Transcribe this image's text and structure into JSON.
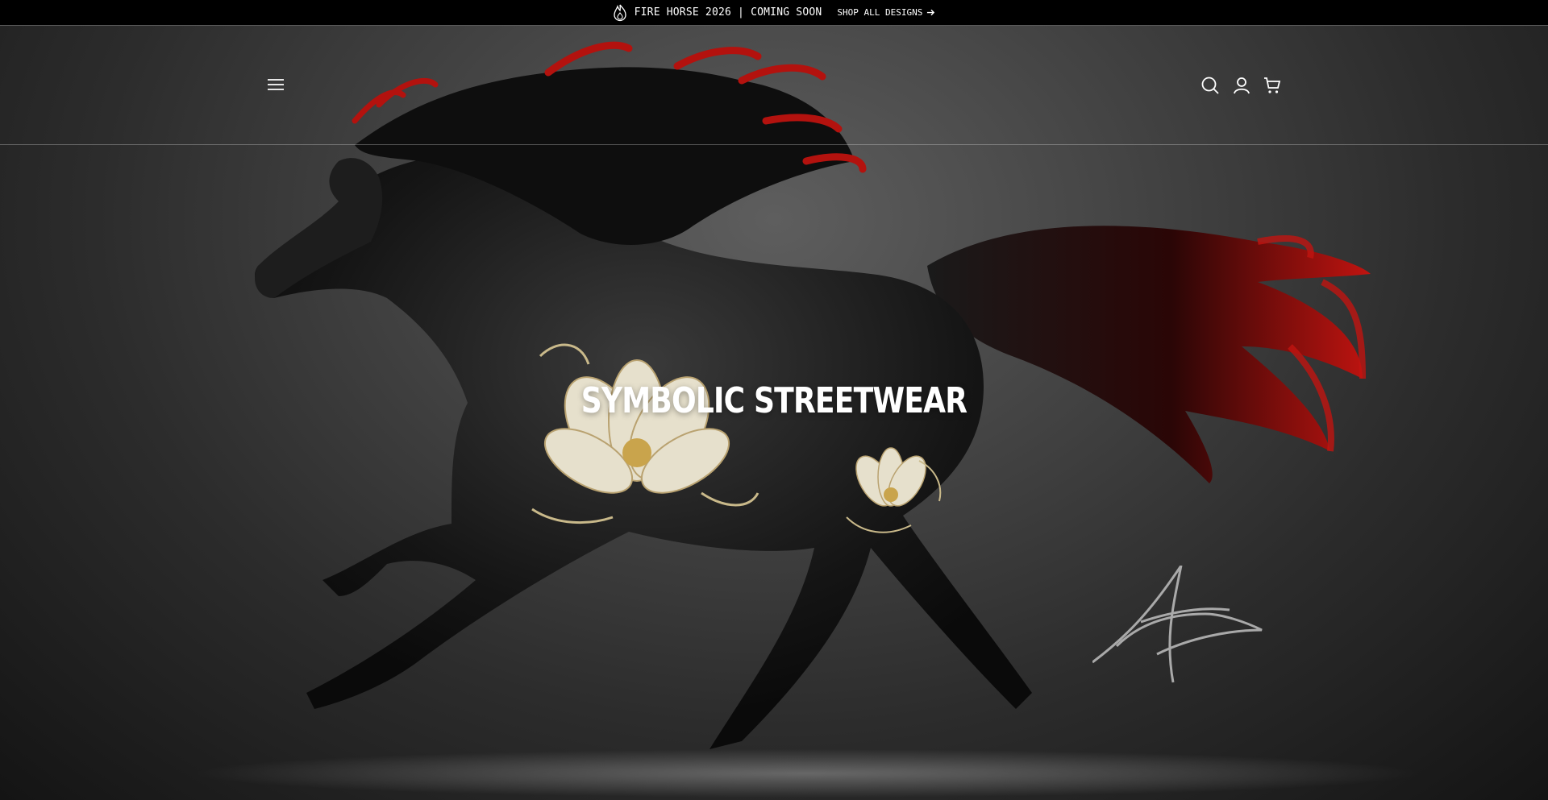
{
  "announcement": {
    "icon": "flame-icon",
    "message": "FIRE HORSE 2026 | COMING SOON",
    "link_label": "SHOP ALL DESIGNS",
    "link_icon": "arrow-right-icon"
  },
  "header": {
    "menu_icon": "hamburger-menu-icon",
    "icons": [
      "search-icon",
      "account-icon",
      "cart-icon"
    ]
  },
  "hero": {
    "title": "SYMBOLIC STREETWEAR",
    "image": "black-horse-with-red-mane-and-gold-lotus-artwork"
  },
  "colors": {
    "announcement_bg": "#000000",
    "text": "#ffffff",
    "mane_red": "#b3120e",
    "lotus_gold": "#c9b98a"
  }
}
